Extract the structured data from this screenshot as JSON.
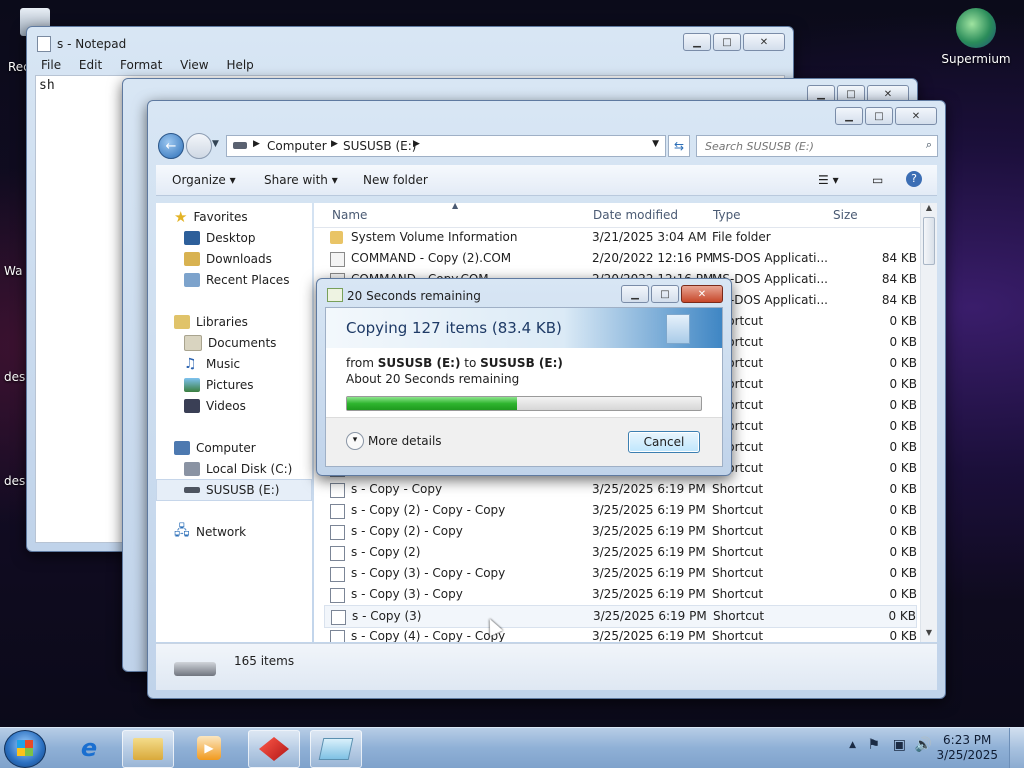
{
  "desktop": {
    "icons": [
      {
        "label": "Supermium"
      },
      {
        "label": "Rec"
      },
      {
        "label": "Wa"
      },
      {
        "label": "des"
      },
      {
        "label": "des"
      }
    ]
  },
  "notepad": {
    "title": "s - Notepad",
    "menu": [
      "File",
      "Edit",
      "Format",
      "View",
      "Help"
    ],
    "content": "sh"
  },
  "explorer": {
    "breadcrumb": [
      "Computer",
      "SUSUSB (E:)"
    ],
    "search_placeholder": "Search SUSUSB (E:)",
    "toolbar": {
      "organize": "Organize",
      "share": "Share with",
      "new_folder": "New folder"
    },
    "nav": {
      "favorites": "Favorites",
      "favorites_items": [
        "Desktop",
        "Downloads",
        "Recent Places"
      ],
      "libraries": "Libraries",
      "libraries_items": [
        "Documents",
        "Music",
        "Pictures",
        "Videos"
      ],
      "computer": "Computer",
      "computer_items": [
        "Local Disk (C:)",
        "SUSUSB (E:)"
      ],
      "network": "Network"
    },
    "columns": [
      "Name",
      "Date modified",
      "Type",
      "Size"
    ],
    "files": [
      {
        "name": "System Volume Information",
        "date": "3/21/2025 3:04 AM",
        "type": "File folder",
        "size": ""
      },
      {
        "name": "COMMAND - Copy (2).COM",
        "date": "2/20/2022 12:16 PM",
        "type": "MS-DOS Applicati...",
        "size": "84 KB"
      },
      {
        "name": "COMMAND - Copy.COM",
        "date": "2/20/2022 12:16 PM",
        "type": "MS-DOS Applicati...",
        "size": "84 KB"
      },
      {
        "name": "",
        "date": "",
        "type": "MS-DOS Applicati...",
        "size": "84 KB"
      },
      {
        "name": "",
        "date": "",
        "type": "Shortcut",
        "size": "0 KB"
      },
      {
        "name": "",
        "date": "",
        "type": "Shortcut",
        "size": "0 KB"
      },
      {
        "name": "",
        "date": "",
        "type": "Shortcut",
        "size": "0 KB"
      },
      {
        "name": "",
        "date": "",
        "type": "Shortcut",
        "size": "0 KB"
      },
      {
        "name": "",
        "date": "",
        "type": "Shortcut",
        "size": "0 KB"
      },
      {
        "name": "",
        "date": "",
        "type": "Shortcut",
        "size": "0 KB"
      },
      {
        "name": "",
        "date": "",
        "type": "Shortcut",
        "size": "0 KB"
      },
      {
        "name": "",
        "date": "",
        "type": "Shortcut",
        "size": "0 KB"
      },
      {
        "name": "s - Copy - Copy",
        "date": "3/25/2025 6:19 PM",
        "type": "Shortcut",
        "size": "0 KB"
      },
      {
        "name": "s - Copy (2) - Copy - Copy",
        "date": "3/25/2025 6:19 PM",
        "type": "Shortcut",
        "size": "0 KB"
      },
      {
        "name": "s - Copy (2) - Copy",
        "date": "3/25/2025 6:19 PM",
        "type": "Shortcut",
        "size": "0 KB"
      },
      {
        "name": "s - Copy (2)",
        "date": "3/25/2025 6:19 PM",
        "type": "Shortcut",
        "size": "0 KB"
      },
      {
        "name": "s - Copy (3) - Copy - Copy",
        "date": "3/25/2025 6:19 PM",
        "type": "Shortcut",
        "size": "0 KB"
      },
      {
        "name": "s - Copy (3) - Copy",
        "date": "3/25/2025 6:19 PM",
        "type": "Shortcut",
        "size": "0 KB"
      },
      {
        "name": "s - Copy (3)",
        "date": "3/25/2025 6:19 PM",
        "type": "Shortcut",
        "size": "0 KB"
      },
      {
        "name": "s - Copy (4) - Copy - Copy",
        "date": "3/25/2025 6:19 PM",
        "type": "Shortcut",
        "size": "0 KB"
      }
    ],
    "status_count": "165 items"
  },
  "copy_dialog": {
    "title": "20 Seconds remaining",
    "heading": "Copying 127 items (83.4 KB)",
    "from_prefix": "from ",
    "from_src": "SUSUSB (E:)",
    "to_word": " to ",
    "from_dst": "SUSUSB (E:)",
    "remaining": "About 20 Seconds remaining",
    "progress_fraction": 0.48,
    "more_details": "More details",
    "cancel": "Cancel"
  },
  "taskbar": {
    "time": "6:23 PM",
    "date": "3/25/2025"
  },
  "colors": {
    "progress": "#2fb52f",
    "accent": "#3c6eb4",
    "taskbar": "#8fb0d6"
  }
}
